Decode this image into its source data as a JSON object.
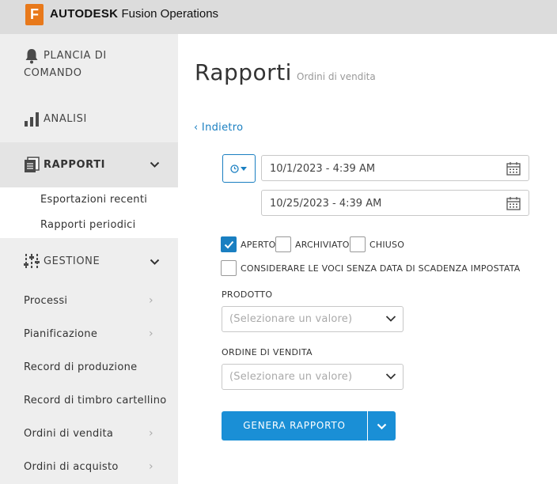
{
  "app": {
    "logo_letter": "F",
    "brand_bold": "AUTODESK",
    "brand_product": "Fusion Operations",
    "accent_color": "#1a7fc1",
    "logo_color": "#e8791b"
  },
  "sidebar": {
    "dashboard": {
      "line1": "PLANCIA DI",
      "line2": "COMANDO",
      "icon": "bell-icon"
    },
    "analysis": {
      "label": "ANALISI",
      "icon": "bar-chart-icon"
    },
    "reports": {
      "label": "RAPPORTI",
      "icon": "documents-icon",
      "expanded": true,
      "items": [
        {
          "label": "Esportazioni recenti"
        },
        {
          "label": "Rapporti periodici"
        }
      ]
    },
    "management": {
      "label": "GESTIONE",
      "icon": "sliders-icon",
      "expanded": true,
      "items": [
        {
          "label": "Processi",
          "has_submenu": true
        },
        {
          "label": "Pianificazione",
          "has_submenu": true
        },
        {
          "label": "Record di produzione",
          "has_submenu": false
        },
        {
          "label": "Record di timbro cartellino",
          "has_submenu": false
        },
        {
          "label": "Ordini di vendita",
          "has_submenu": true
        },
        {
          "label": "Ordini di acquisto",
          "has_submenu": true
        }
      ]
    }
  },
  "main": {
    "title": "Rapporti",
    "subtitle": "Ordini di vendita",
    "back_label": "‹ Indietro",
    "date_from": "10/1/2023 - 4:39 AM",
    "date_to": "10/25/2023 - 4:39 AM",
    "status_filters": [
      {
        "label": "APERTO",
        "checked": true
      },
      {
        "label": "ARCHIVIATO",
        "checked": false
      },
      {
        "label": "CHIUSO",
        "checked": false
      }
    ],
    "no_due_date": {
      "label": "CONSIDERARE LE VOCI SENZA DATA DI SCADENZA IMPOSTATA",
      "checked": false
    },
    "product": {
      "label": "PRODOTTO",
      "placeholder": "(Selezionare un valore)"
    },
    "sales_order": {
      "label": "ORDINE DI VENDITA",
      "placeholder": "(Selezionare un valore)"
    },
    "generate_label": "GENERA RAPPORTO"
  }
}
